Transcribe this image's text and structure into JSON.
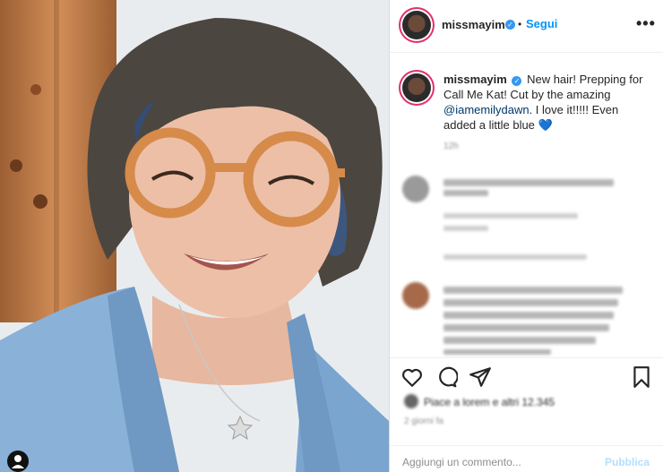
{
  "header": {
    "username": "missmayim",
    "separator": "•",
    "follow_label": "Segui",
    "more_label": "•••"
  },
  "caption": {
    "username": "missmayim",
    "text_before_mention": "New hair! Prepping for Call Me Kat! Cut by the amazing ",
    "mention": "@iamemilydawn",
    "text_after_mention": ". I love it!!!!! Even added a little blue ",
    "emoji": "💙"
  },
  "blurred": {
    "caption_time": "12h",
    "likes": "Piace a lorem e altri 12.345",
    "time_ago": "2 giorni fa"
  },
  "comment_box": {
    "placeholder": "Aggiungi un commento...",
    "publish_label": "Pubblica"
  },
  "colors": {
    "accent": "#0095f6",
    "verified": "#3897f0",
    "publish_disabled": "#b2dffc",
    "story_ring": "#e1306c"
  },
  "icons": [
    "more-options-icon",
    "verified-badge-icon",
    "heart-icon",
    "comment-icon",
    "share-icon",
    "bookmark-icon",
    "user-tag-icon"
  ]
}
